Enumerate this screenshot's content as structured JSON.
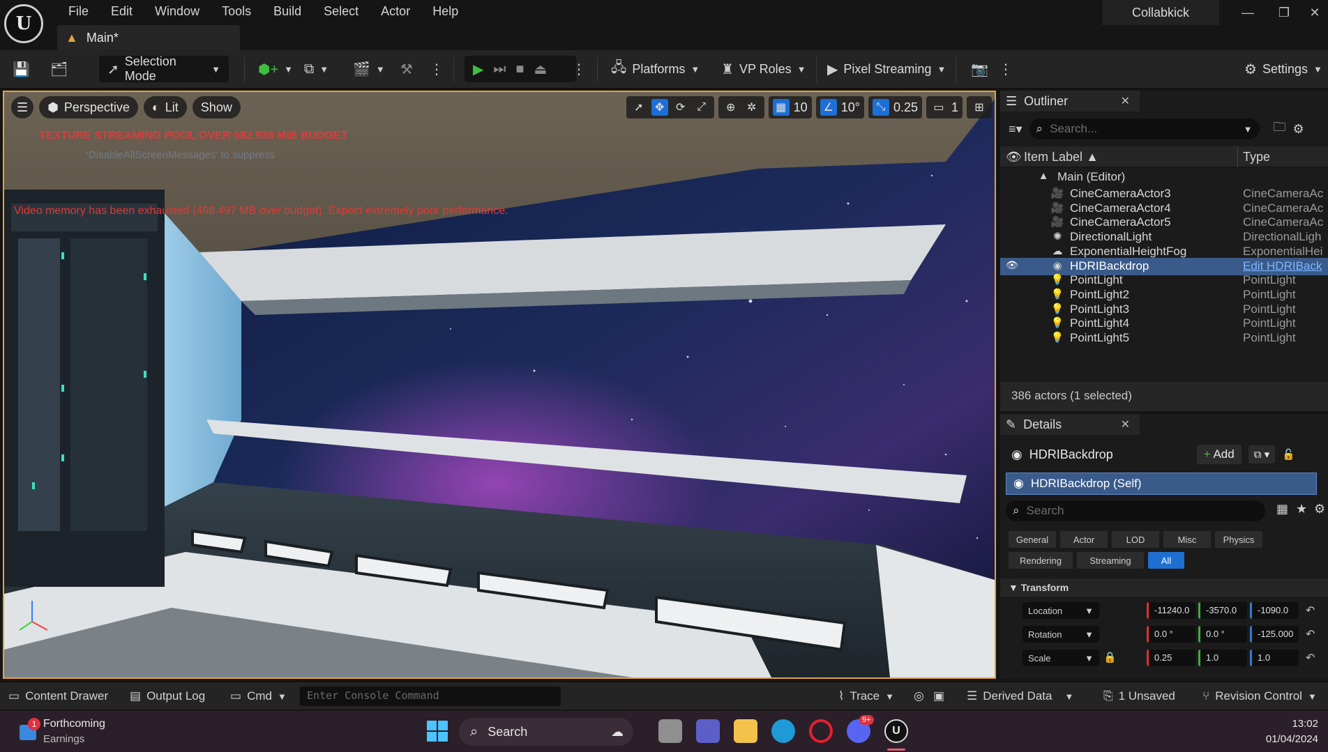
{
  "menu": [
    "File",
    "Edit",
    "Window",
    "Tools",
    "Build",
    "Select",
    "Actor",
    "Help"
  ],
  "doc_tab": "Main*",
  "app_title": "Collabkick",
  "toolbar": {
    "selection_mode": "Selection Mode",
    "platforms": "Platforms",
    "vp_roles": "VP Roles",
    "pixel_streaming": "Pixel Streaming",
    "settings": "Settings"
  },
  "viewport": {
    "perspective": "Perspective",
    "lit": "Lit",
    "show": "Show",
    "grid_snap": "10",
    "rotation_snap": "10°",
    "scale_snap": "0.25",
    "camera_speed": "1",
    "warning_texture": "TEXTURE STREAMING POOL OVER 582.938 MiB BUDGET",
    "warning_suppress": "'DisableAllScreenMessages' to suppress",
    "warning_memory": "Video memory has been exhausted (468.497 MB over budget). Expect extremely poor performance."
  },
  "outliner": {
    "tab": "Outliner",
    "search_placeholder": "Search...",
    "col_label": "Item Label",
    "col_type": "Type",
    "root": "Main (Editor)",
    "rows": [
      {
        "name": "CineCameraActor3",
        "type": "CineCameraAc"
      },
      {
        "name": "CineCameraActor4",
        "type": "CineCameraAc"
      },
      {
        "name": "CineCameraActor5",
        "type": "CineCameraAc"
      },
      {
        "name": "DirectionalLight",
        "type": "DirectionalLigh"
      },
      {
        "name": "ExponentialHeightFog",
        "type": "ExponentialHei"
      },
      {
        "name": "HDRIBackdrop",
        "type": "Edit HDRIBack"
      },
      {
        "name": "PointLight",
        "type": "PointLight"
      },
      {
        "name": "PointLight2",
        "type": "PointLight"
      },
      {
        "name": "PointLight3",
        "type": "PointLight"
      },
      {
        "name": "PointLight4",
        "type": "PointLight"
      },
      {
        "name": "PointLight5",
        "type": "PointLight"
      }
    ],
    "footer": "386 actors (1 selected)"
  },
  "details": {
    "tab": "Details",
    "actor": "HDRIBackdrop",
    "add_label": "Add",
    "self_label": "HDRIBackdrop (Self)",
    "search_placeholder": "Search",
    "categories_row1": [
      "General",
      "Actor",
      "LOD",
      "Misc",
      "Physics"
    ],
    "categories_row2": [
      "Rendering",
      "Streaming",
      "All"
    ],
    "transform_header": "Transform",
    "location_label": "Location",
    "rotation_label": "Rotation",
    "scale_label": "Scale",
    "location": [
      "-11240.0",
      "-3570.0",
      "-1090.0"
    ],
    "rotation": [
      "0.0 °",
      "0.0 °",
      "-125.000"
    ],
    "scale": [
      "0.25",
      "1.0",
      "1.0"
    ]
  },
  "statusbar": {
    "content_drawer": "Content Drawer",
    "output_log": "Output Log",
    "cmd": "Cmd",
    "console_placeholder": "Enter Console Command",
    "trace": "Trace",
    "derived_data": "Derived Data",
    "unsaved": "1 Unsaved",
    "revision_control": "Revision Control"
  },
  "taskbar": {
    "news_title": "Forthcoming",
    "news_sub": "Earnings",
    "news_badge": "1",
    "search": "Search",
    "discord_badge": "9+",
    "time": "13:02",
    "date": "01/04/2024"
  }
}
